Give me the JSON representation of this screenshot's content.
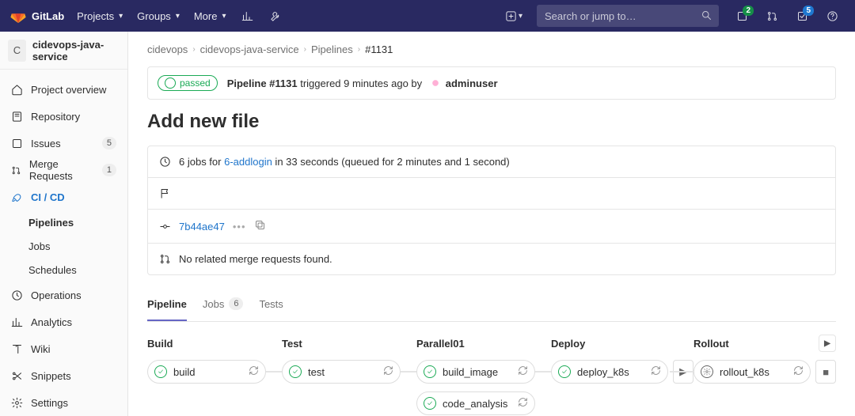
{
  "topnav": {
    "brand": "GitLab",
    "menu": [
      "Projects",
      "Groups",
      "More"
    ],
    "search_placeholder": "Search or jump to…",
    "todos_count": "2",
    "issues_count": "5"
  },
  "project": {
    "initial": "C",
    "name": "cidevops-java-service"
  },
  "sidebar": {
    "items": [
      {
        "icon": "home",
        "label": "Project overview"
      },
      {
        "icon": "repo",
        "label": "Repository"
      },
      {
        "icon": "issue",
        "label": "Issues",
        "count": "5"
      },
      {
        "icon": "mr",
        "label": "Merge Requests",
        "count": "1"
      },
      {
        "icon": "cicd",
        "label": "CI / CD",
        "active": true,
        "subs": [
          "Pipelines",
          "Jobs",
          "Schedules"
        ],
        "activeSub": 0
      },
      {
        "icon": "ops",
        "label": "Operations"
      },
      {
        "icon": "analytics",
        "label": "Analytics"
      },
      {
        "icon": "wiki",
        "label": "Wiki"
      },
      {
        "icon": "snip",
        "label": "Snippets"
      },
      {
        "icon": "settings",
        "label": "Settings"
      }
    ]
  },
  "breadcrumbs": [
    "cidevops",
    "cidevops-java-service",
    "Pipelines",
    "#1131"
  ],
  "status": {
    "badge": "passed",
    "prefix": "Pipeline #1131",
    "mid": " triggered 9 minutes ago by ",
    "user": "adminuser"
  },
  "page_title": "Add new file",
  "info": {
    "summary_pre": "6 jobs for ",
    "branch": "6-addlogin",
    "summary_post": " in 33 seconds (queued for 2 minutes and 1 second)",
    "sha": "7b44ae47",
    "mr_msg": "No related merge requests found."
  },
  "tabs": [
    {
      "label": "Pipeline",
      "active": true
    },
    {
      "label": "Jobs",
      "count": "6"
    },
    {
      "label": "Tests"
    }
  ],
  "stages": [
    {
      "name": "Build",
      "jobs": [
        {
          "name": "build",
          "status": "ok"
        }
      ]
    },
    {
      "name": "Test",
      "jobs": [
        {
          "name": "test",
          "status": "ok"
        }
      ]
    },
    {
      "name": "Parallel01",
      "jobs": [
        {
          "name": "build_image",
          "status": "ok"
        },
        {
          "name": "code_analysis",
          "status": "ok"
        }
      ]
    },
    {
      "name": "Deploy",
      "jobs": [
        {
          "name": "deploy_k8s",
          "status": "ok",
          "action": "play"
        }
      ]
    },
    {
      "name": "Rollout",
      "run": true,
      "jobs": [
        {
          "name": "rollout_k8s",
          "status": "manual",
          "action": "stop"
        }
      ]
    }
  ]
}
